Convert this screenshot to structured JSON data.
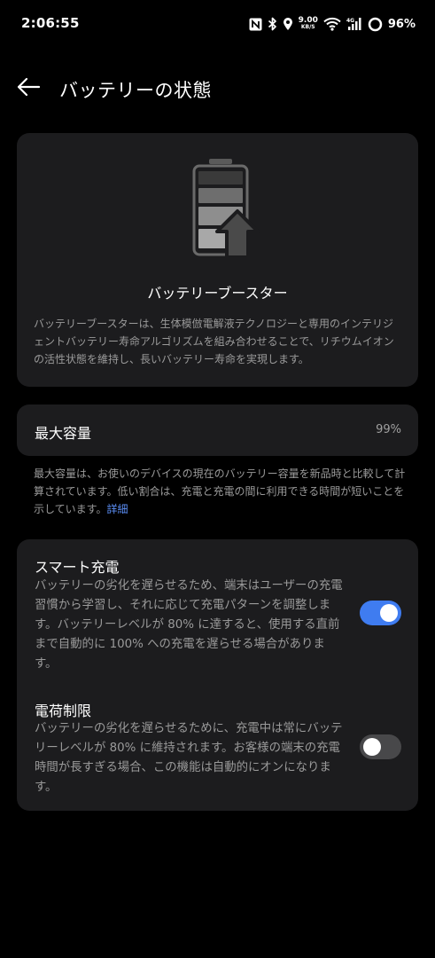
{
  "status_bar": {
    "time": "2:06:55",
    "net_speed": "9.00",
    "net_speed_unit": "KB/S",
    "battery_percent": "96%",
    "icons": [
      "nfc-icon",
      "bluetooth-icon",
      "location-icon",
      "wifi-icon",
      "signal-4g-icon",
      "battery-ring-icon"
    ]
  },
  "header": {
    "title": "バッテリーの状態"
  },
  "booster": {
    "title": "バッテリーブースター",
    "description": "バッテリーブースターは、生体模倣電解液テクノロジーと専用のインテリジェントバッテリー寿命アルゴリズムを組み合わせることで、リチウムイオンの活性状態を維持し、長いバッテリー寿命を実現します。"
  },
  "capacity": {
    "label": "最大容量",
    "value": "99%",
    "note": "最大容量は、お使いのデバイスの現在のバッテリー容量を新品時と比較して計算されています。低い割合は、充電と充電の間に利用できる時間が短いことを示しています。",
    "link": "詳細"
  },
  "smart_charging": {
    "title": "スマート充電",
    "description": "バッテリーの劣化を遅らせるため、端末はユーザーの充電習慣から学習し、それに応じて充電パターンを調整します。バッテリーレベルが 80% に達すると、使用する直前まで自動的に 100% への充電を遅らせる場合があります。",
    "enabled": true
  },
  "charge_limit": {
    "title": "電荷制限",
    "description": "バッテリーの劣化を遅らせるために、充電中は常にバッテリーレベルが 80% に維持されます。お客様の端末の充電時間が長すぎる場合、この機能は自動的にオンになります。",
    "enabled": false
  },
  "colors": {
    "background": "#000000",
    "card": "#1c1c1e",
    "accent": "#3f7cf0",
    "link": "#5b8ef5",
    "secondary_text": "#9a9a9a"
  }
}
